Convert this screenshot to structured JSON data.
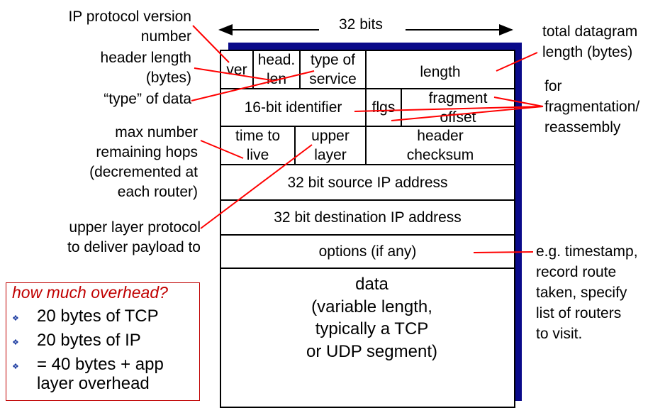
{
  "bits_label": "32 bits",
  "fields": {
    "ver": "ver",
    "head_len_1": "head.",
    "head_len_2": "len",
    "tos_1": "type of",
    "tos_2": "service",
    "length": "length",
    "identifier": "16-bit identifier",
    "flags": "flgs",
    "frag_1": "fragment",
    "frag_2": "offset",
    "ttl_1": "time to",
    "ttl_2": "live",
    "upper_1": "upper",
    "upper_2": "layer",
    "checksum_1": "header",
    "checksum_2": "checksum",
    "src": "32 bit source IP address",
    "dst": "32 bit destination IP address",
    "options": "options (if any)",
    "data_1": "data",
    "data_2": "(variable length,",
    "data_3": "typically a TCP",
    "data_4": "or UDP segment)"
  },
  "left_labels": {
    "version_1": "IP protocol version",
    "version_2": "number",
    "hlen_1": "header length",
    "hlen_2": "(bytes)",
    "type": "“type” of data",
    "hops_1": "max number",
    "hops_2": "remaining hops",
    "hops_3": "(decremented at",
    "hops_4": "each router)",
    "proto_1": "upper layer protocol",
    "proto_2": "to deliver payload to"
  },
  "right_labels": {
    "total_1": "total datagram",
    "total_2": "length (bytes)",
    "frag_1": "for",
    "frag_2": "fragmentation/",
    "frag_3": "reassembly",
    "opt_1": "e.g. timestamp,",
    "opt_2": "record route",
    "opt_3": "taken, specify",
    "opt_4": "list of routers",
    "opt_5": "to visit."
  },
  "overhead": {
    "title": "how much overhead?",
    "items": [
      "20 bytes of TCP",
      "20 bytes of IP",
      "= 40 bytes + app",
      "layer overhead"
    ]
  },
  "colors": {
    "annotation_line": "#ff0000",
    "shadow": "#0a0a8a",
    "overhead_title": "#c00000"
  }
}
